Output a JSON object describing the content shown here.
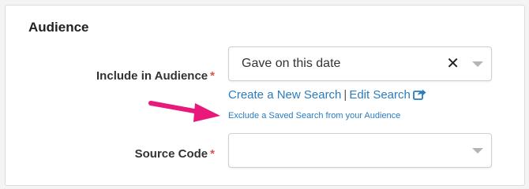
{
  "section": {
    "title": "Audience"
  },
  "audience": {
    "label": "Include in Audience",
    "required_marker": "*",
    "selected_value": "Gave on this date",
    "clear_glyph": "✕",
    "create_link": "Create a New Search",
    "separator": "|",
    "edit_link": "Edit Search",
    "exclude_link": "Exclude a Saved Search from your Audience"
  },
  "source_code": {
    "label": "Source Code",
    "required_marker": "*",
    "selected_value": ""
  },
  "colors": {
    "link": "#2a7cbf",
    "required": "#d9534f",
    "annotation_arrow": "#e8197a"
  },
  "icons": {
    "edit": "share-arrow-icon",
    "chevron": "chevron-down-icon",
    "clear": "close-icon"
  }
}
